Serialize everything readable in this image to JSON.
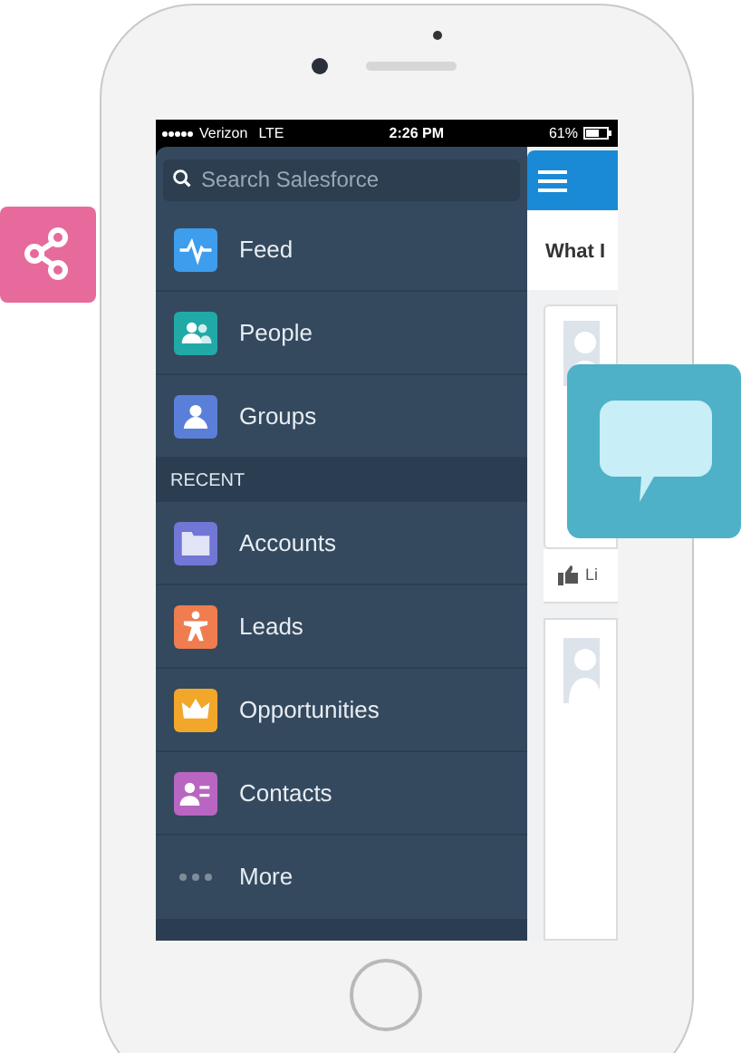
{
  "status_bar": {
    "carrier": "Verizon",
    "network": "LTE",
    "time": "2:26 PM",
    "battery": "61%"
  },
  "search": {
    "placeholder": "Search Salesforce"
  },
  "menu": [
    {
      "label": "Feed",
      "color": "#3e9ded"
    },
    {
      "label": "People",
      "color": "#21a9a7"
    },
    {
      "label": "Groups",
      "color": "#5a7fd8"
    }
  ],
  "recent": {
    "heading": "RECENT",
    "items": [
      {
        "label": "Accounts",
        "color": "#7177d4"
      },
      {
        "label": "Leads",
        "color": "#ef7d4f"
      },
      {
        "label": "Opportunities",
        "color": "#f2a72b"
      },
      {
        "label": "Contacts",
        "color": "#b866c1"
      }
    ]
  },
  "more": {
    "label": "More"
  },
  "feed": {
    "heading": "What I",
    "like": "Li"
  }
}
